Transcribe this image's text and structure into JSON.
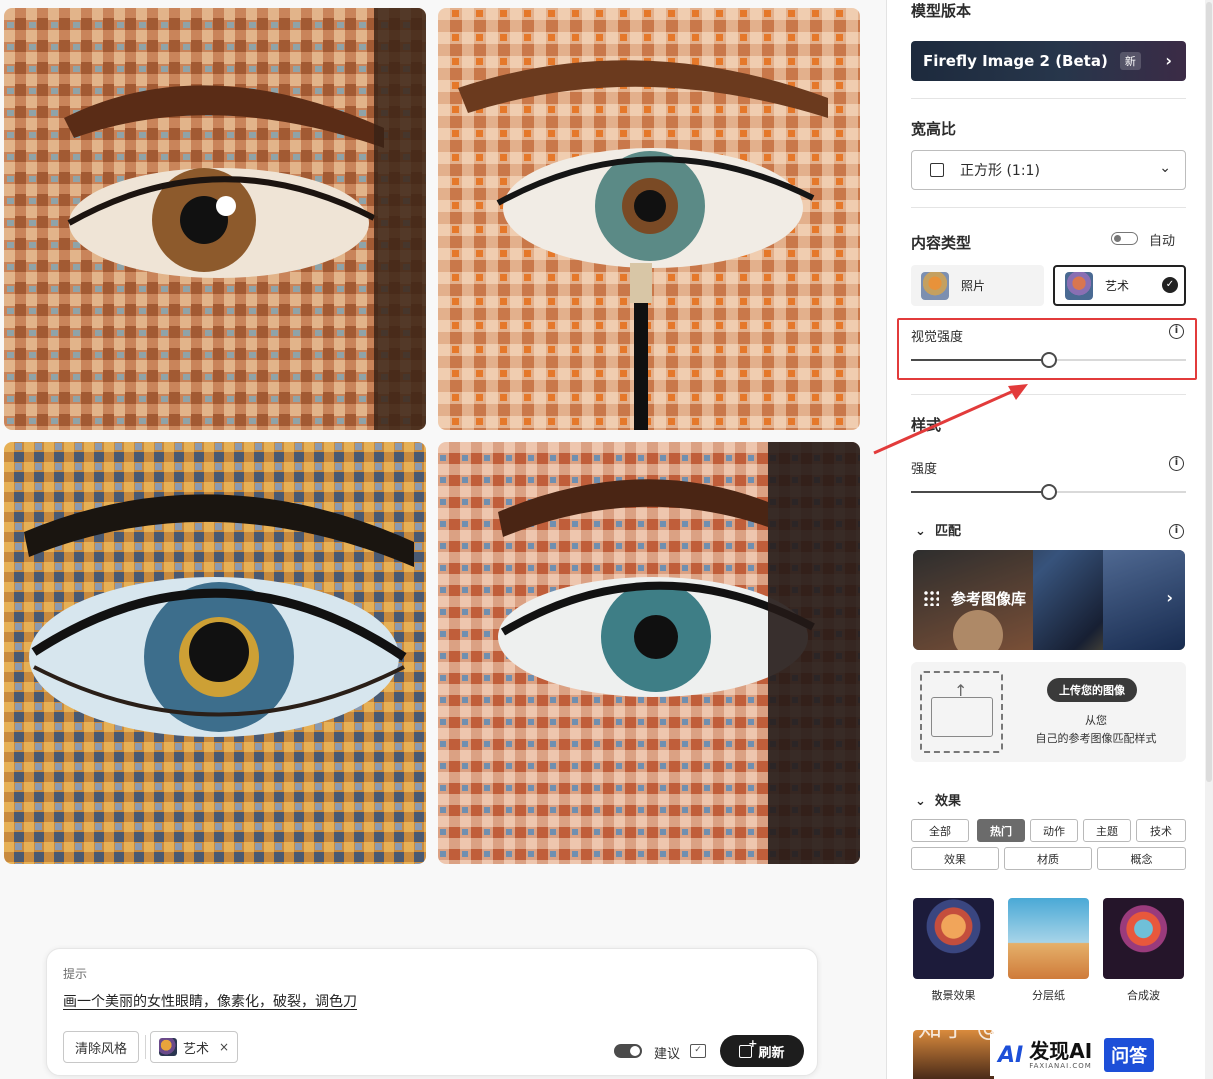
{
  "gallery": {
    "images": [
      "generated-image-1",
      "generated-image-2",
      "generated-image-3",
      "generated-image-4"
    ]
  },
  "prompt": {
    "label": "提示",
    "text": "画一个美丽的女性眼睛，像素化，破裂，调色刀",
    "clear_style": "清除风格",
    "style_chip": "艺术",
    "style_chip_remove": "×",
    "suggest_label": "建议",
    "refresh_label": "刷新"
  },
  "panel": {
    "model_version": {
      "title": "模型版本",
      "value": "Firefly Image 2 (Beta)",
      "badge": "新"
    },
    "aspect_ratio": {
      "title": "宽高比",
      "value": "正方形 (1:1)"
    },
    "content_type": {
      "title": "内容类型",
      "auto_label": "自动",
      "auto_enabled": false,
      "options": [
        {
          "label": "照片",
          "selected": false
        },
        {
          "label": "艺术",
          "selected": true
        }
      ]
    },
    "visual_intensity": {
      "label": "视觉强度",
      "value": 0.5
    },
    "style": {
      "title": "样式",
      "strength_label": "强度",
      "strength_value": 0.5
    },
    "match": {
      "title": "匹配",
      "reference_library": "参考图像库",
      "upload_button": "上传您的图像",
      "upload_line1": "从您",
      "upload_line2": "自己的参考图像匹配样式"
    },
    "effects": {
      "title": "效果",
      "tabs": [
        {
          "label": "全部",
          "active": false
        },
        {
          "label": "热门",
          "active": true
        },
        {
          "label": "动作",
          "active": false
        },
        {
          "label": "主题",
          "active": false
        },
        {
          "label": "技术",
          "active": false
        },
        {
          "label": "效果",
          "active": false
        },
        {
          "label": "材质",
          "active": false
        },
        {
          "label": "概念",
          "active": false
        }
      ],
      "items": [
        {
          "label": "散景效果"
        },
        {
          "label": "分层纸"
        },
        {
          "label": "合成波"
        }
      ]
    }
  },
  "overlay": {
    "watermark": "知乎 @听雨ACI",
    "logo_mark": "AI",
    "logo_name": "发现AI",
    "logo_domain": "FAXIANAI.COM",
    "logo_tag": "问答"
  },
  "colors": {
    "annotation_red": "#e23b3b",
    "refresh_button": "#1d1d1d",
    "logo_blue": "#1d4fd8"
  }
}
